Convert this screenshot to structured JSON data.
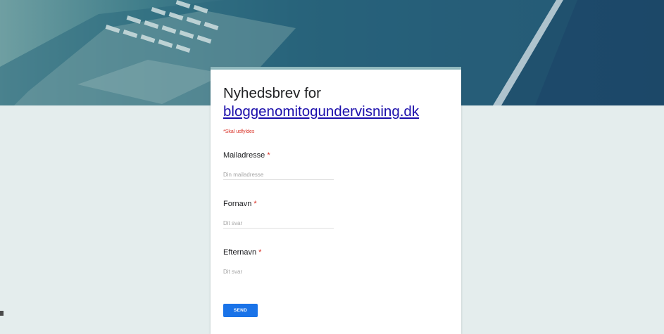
{
  "form": {
    "title_prefix": "Nyhedsbrev for",
    "title_link": "bloggenomitogundervisning.dk",
    "required_note": "*Skal udfyldes",
    "questions": [
      {
        "label": "Mailadresse",
        "required_marker": "*",
        "placeholder": "Din mailadresse"
      },
      {
        "label": "Fornavn",
        "required_marker": "*",
        "placeholder": "Dit svar"
      },
      {
        "label": "Efternavn",
        "required_marker": "*",
        "placeholder": "Dit svar"
      }
    ],
    "submit_label": "SEND"
  },
  "colors": {
    "header_start": "#6f9fa2",
    "header_end": "#1d4a6b",
    "accent": "#1a73e8",
    "required": "#d93025",
    "link": "#1a0dab",
    "page_background": "#e4eded"
  },
  "icons": {
    "header_image": "laptop-keyboard-photo"
  }
}
